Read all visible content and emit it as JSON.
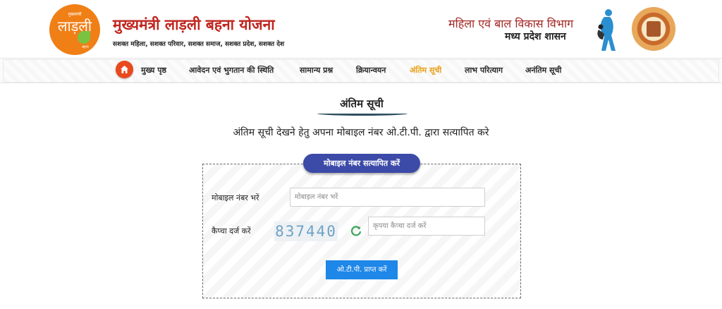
{
  "header": {
    "logo_text_top": "मुख्यमंत्री",
    "logo_text_main": "लाड़ली",
    "logo_text_bottom": "बहना",
    "title": "मुख्यमंत्री लाड़ली बहना योजना",
    "tagline": "सशक्त महिला, सशक्त परिवार, सशक्त समाज, सशक्त प्रदेश, सशक्त देश",
    "dept_name": "महिला एवं बाल विकास विभाग",
    "gov_name": "मध्य प्रदेश शासन"
  },
  "nav": {
    "home_icon": "home-icon",
    "items": [
      {
        "label": "मुख्य पृष्ठ"
      },
      {
        "label": "आवेदन एवं भुगतान की स्थिति"
      },
      {
        "label": "सामान्य प्रश्न"
      },
      {
        "label": "क्रियान्वयन"
      },
      {
        "label": "अंतिम सूची"
      },
      {
        "label": "लाभ परित्याग"
      },
      {
        "label": "अनंतिम सूची"
      }
    ],
    "active_index": 4,
    "active_color": "#e9a21b"
  },
  "main": {
    "heading": "अंतिम सूची",
    "instruction": "अंतिम सूची देखने हेतु अपना मोबाइल नंबर ओ.टी.पी. द्वारा सत्यापित करे"
  },
  "form": {
    "badge": "मोबाइल नंबर सत्यापित करें",
    "mobile_label": "मोबाइल नंबर भरें",
    "mobile_placeholder": "मोबाइल नंबर भरें",
    "mobile_value": "",
    "captcha_label": "कैप्चा दर्ज करें",
    "captcha_code": "837440",
    "captcha_placeholder": "कृपया कैप्चा दर्ज करें",
    "captcha_value": "",
    "refresh_icon": "refresh-icon",
    "submit_label": "ओ.टी.पी. प्राप्त करें",
    "submit_color": "#1f87e8",
    "badge_color": "#3c4aa8"
  }
}
